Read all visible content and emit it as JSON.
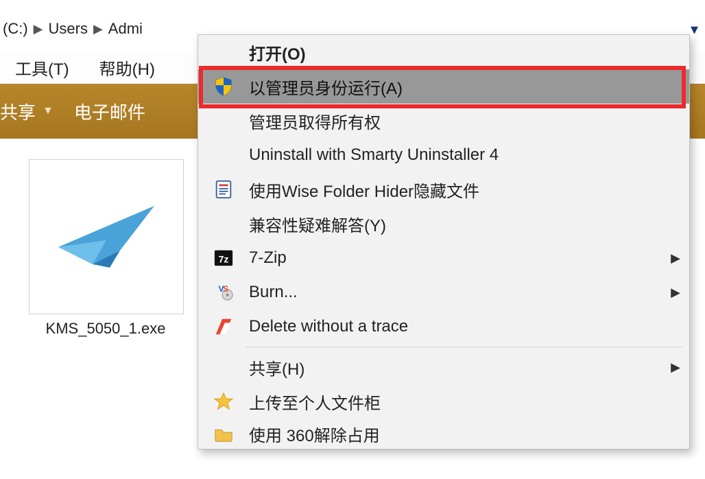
{
  "breadcrumb": {
    "drive": "(C:)",
    "users": "Users",
    "admin": "Admi"
  },
  "menubar": {
    "tools": "工具(T)",
    "help": "帮助(H)"
  },
  "cmdbar": {
    "share": "共享",
    "email": "电子邮件"
  },
  "file": {
    "name": "KMS_5050_1.exe"
  },
  "ctx": {
    "open": "打开(O)",
    "runas_admin": "以管理员身份运行(A)",
    "admin_take_ownership": "管理员取得所有权",
    "smarty_uninstall": "Uninstall with Smarty Uninstaller 4",
    "wise_folder_hider": "使用Wise Folder Hider隐藏文件",
    "compat_troubleshoot": "兼容性疑难解答(Y)",
    "seven_zip": "7-Zip",
    "burn": "Burn...",
    "delete_without_trace": "Delete without a trace",
    "share": "共享(H)",
    "upload_locker": "上传至个人文件柜",
    "use_360_unlock": "使用 360解除占用"
  }
}
